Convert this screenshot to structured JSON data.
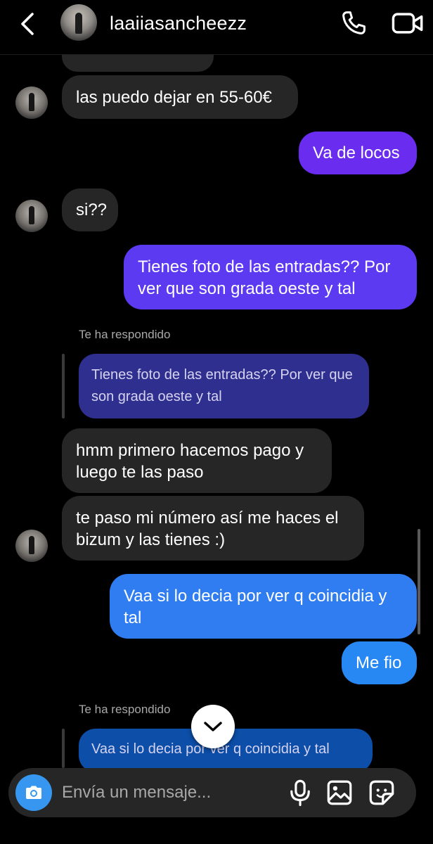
{
  "header": {
    "username": "laaiiasancheezz",
    "icons": {
      "back": "chevron-left-icon",
      "call": "phone-icon",
      "video": "video-camera-icon"
    }
  },
  "messages": [
    {
      "side": "in",
      "text": "las puedo dejar en 55-60€"
    },
    {
      "side": "out",
      "text": "Va de locos"
    },
    {
      "side": "in",
      "text": "si??"
    },
    {
      "side": "out",
      "text": "Tienes foto de las entradas?? Por ver que son grada oeste y tal"
    },
    {
      "side": "in",
      "reply_label": "Te ha respondido",
      "quoted": "Tienes foto de las entradas?? Por ver que son grada oeste y tal",
      "text": "hmm primero hacemos pago y luego te las paso"
    },
    {
      "side": "in",
      "text": "te paso mi número así me haces el bizum y las tienes :)"
    },
    {
      "side": "out",
      "text": "Vaa si lo decia por ver q coincidia y tal"
    },
    {
      "side": "out",
      "text": "Me fio"
    },
    {
      "side": "in",
      "reply_label": "Te ha respondido",
      "quoted": "Vaa si lo decia por ver q coincidia y tal"
    }
  ],
  "composer": {
    "placeholder": "Envía un mensaje...",
    "icons": [
      "camera-icon",
      "microphone-icon",
      "gallery-icon",
      "sticker-icon"
    ]
  },
  "jump_button_icon": "chevron-down-icon",
  "colors": {
    "background": "#000000",
    "incoming_bubble": "#262626",
    "outgoing_gradient": [
      "#6a2cf0",
      "#4a4ff0",
      "#2f7df0",
      "#1e8cf5"
    ],
    "quoted_purple": "#2e2f8f",
    "quoted_blue": "#0c4ea8",
    "accent_blue": "#3797f0",
    "secondary_text": "#a8a8a8"
  }
}
